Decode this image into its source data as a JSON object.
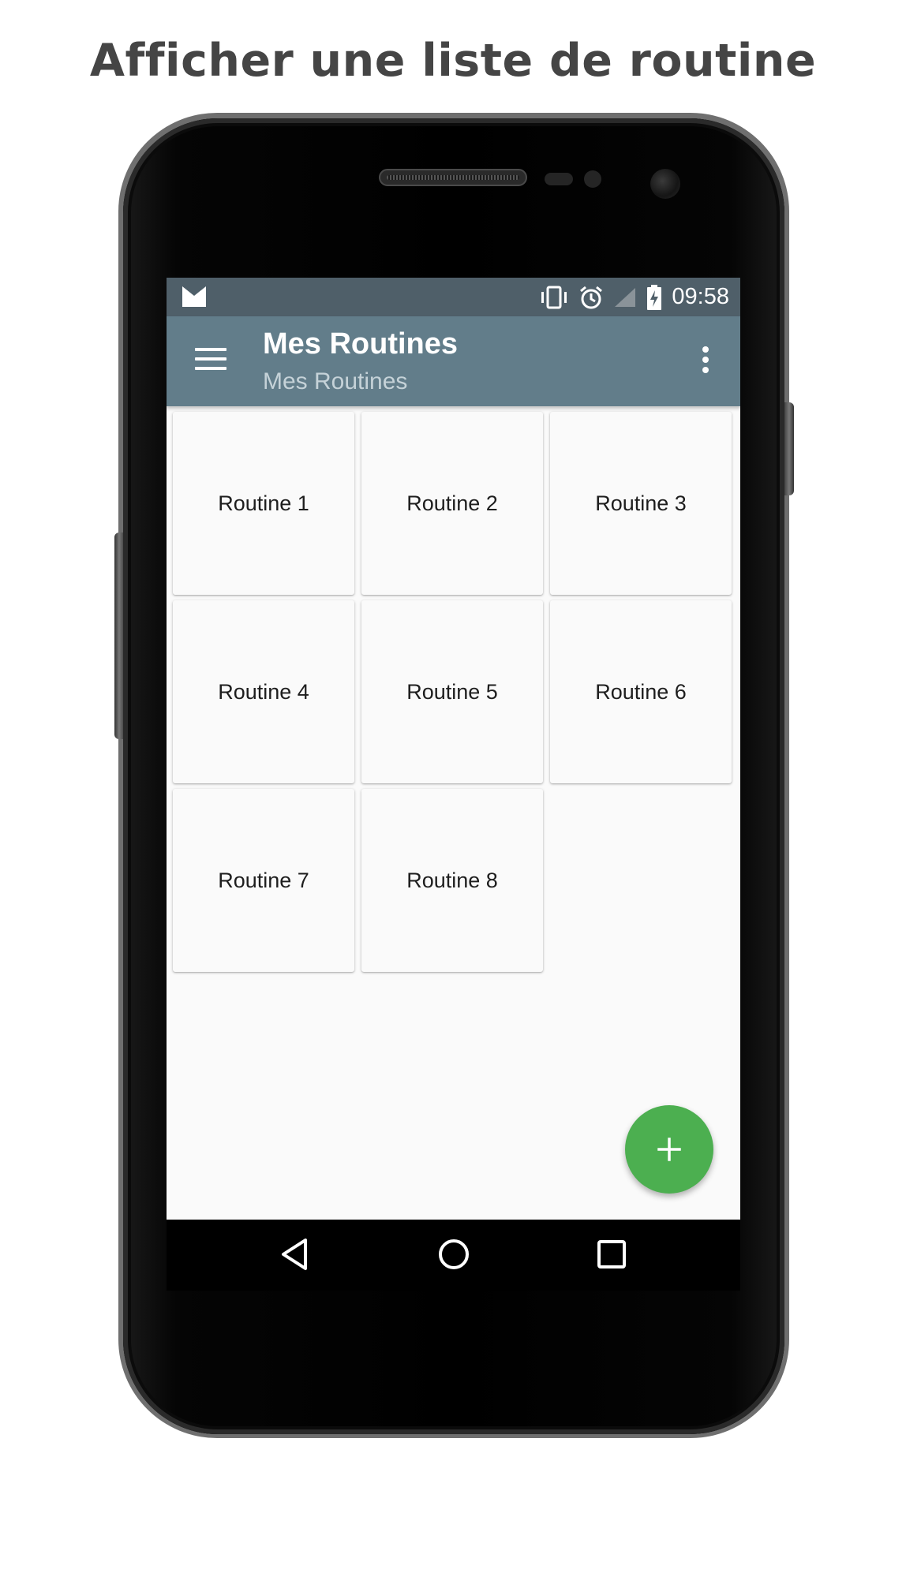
{
  "caption": "Afficher une liste de routine",
  "status_bar": {
    "time": "09:58",
    "icons": [
      "mail-icon",
      "vibrate-icon",
      "alarm-icon",
      "signal-icon",
      "battery-charging-icon"
    ]
  },
  "app_bar": {
    "title": "Mes Routines",
    "subtitle": "Mes Routines"
  },
  "routines": [
    "Routine 1",
    "Routine 2",
    "Routine 3",
    "Routine 4",
    "Routine 5",
    "Routine 6",
    "Routine 7",
    "Routine 8"
  ],
  "colors": {
    "status_bar": "#4f5f69",
    "app_bar": "#627d8a",
    "fab": "#4caf50",
    "background": "#fafafa"
  },
  "fab": {
    "icon": "plus-icon"
  },
  "nav": [
    "back-icon",
    "home-icon",
    "recents-icon"
  ]
}
